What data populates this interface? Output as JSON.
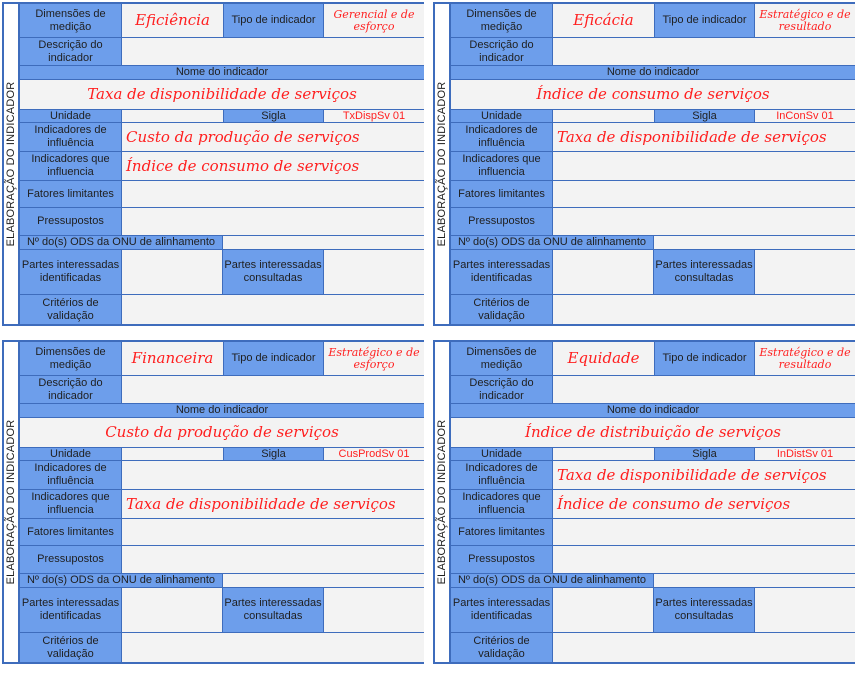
{
  "labels": {
    "side_title": "ELABORAÇÃO DO INDICADOR",
    "dimensoes": "Dimensões de medição",
    "tipo": "Tipo de indicador",
    "descricao": "Descrição do indicador",
    "nome": "Nome do indicador",
    "unidade": "Unidade",
    "sigla": "Sigla",
    "ind_influencia": "Indicadores de influência",
    "ind_que_influencia": "Indicadores que influencia",
    "fatores": "Fatores limitantes",
    "pressupostos": "Pressupostos",
    "ods": "Nº do(s) ODS da ONU de alinhamento",
    "partes_ident": "Partes interessadas identificadas",
    "partes_cons": "Partes interessadas consultadas",
    "criterios": "Critérios de validação"
  },
  "cards": [
    {
      "dimensao": "Eficiência",
      "tipo": "Gerencial e de esforço",
      "nome": "Taxa de disponibilidade de serviços",
      "sigla": "TxDispSv 01",
      "influencia": "Custo da produção de serviços",
      "que_influencia": "Índice de consumo de serviços"
    },
    {
      "dimensao": "Eficácia",
      "tipo": "Estratégico e de resultado",
      "nome": "Índice de consumo de serviços",
      "sigla": "InConSv 01",
      "influencia": "Taxa de disponibilidade de serviços",
      "que_influencia": ""
    },
    {
      "dimensao": "Financeira",
      "tipo": "Estratégico e de esforço",
      "nome": "Custo da produção de serviços",
      "sigla": "CusProdSv 01",
      "influencia": "",
      "que_influencia": "Taxa de disponibilidade de serviços"
    },
    {
      "dimensao": "Equidade",
      "tipo": "Estratégico e de resultado",
      "nome": "Índice de distribuição de serviços",
      "sigla": "InDistSv 01",
      "influencia": "Taxa de disponibilidade de serviços",
      "que_influencia": "Índice de consumo de serviços"
    }
  ],
  "colors": {
    "label_bg": "#6d9eeb",
    "border": "#3e6cbc",
    "handwriting": "#ff1f1f"
  }
}
